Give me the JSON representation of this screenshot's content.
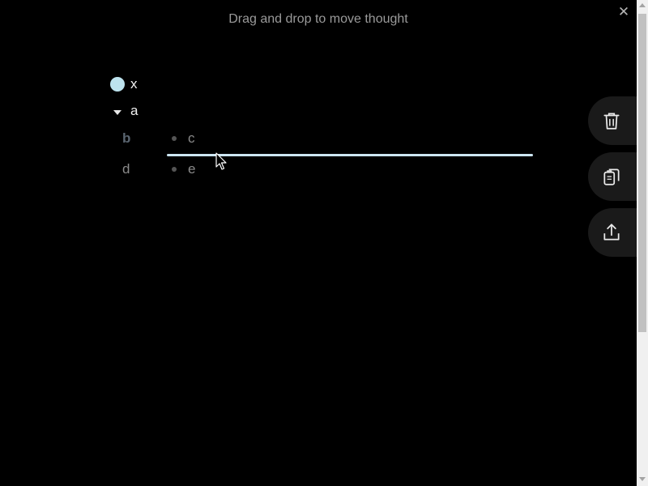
{
  "header": {
    "drag_hint": "Drag and drop to move thought",
    "close_label": "✕"
  },
  "thoughts": {
    "x": {
      "label": "x"
    },
    "a": {
      "label": "a"
    },
    "b": {
      "label": "b"
    },
    "c": {
      "label": "c"
    },
    "d": {
      "label": "d"
    },
    "e": {
      "label": "e"
    }
  },
  "sidebar_buttons": [
    {
      "icon": "trash-icon"
    },
    {
      "icon": "copy-clipboard-icon"
    },
    {
      "icon": "share-icon"
    }
  ],
  "colors": {
    "background": "#000000",
    "drop_line": "#cde6f3",
    "focused_bullet": "#bde3ee"
  }
}
